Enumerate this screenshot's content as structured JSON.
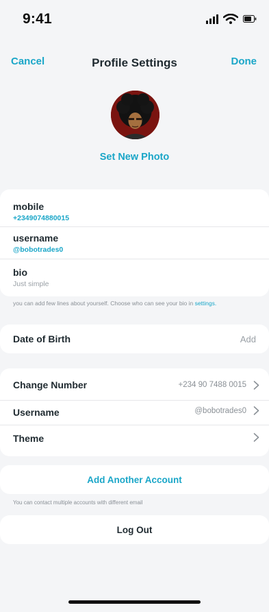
{
  "status": {
    "time": "9:41"
  },
  "nav": {
    "cancel": "Cancel",
    "title": "Profile Settings",
    "done": "Done"
  },
  "photo": {
    "set_label": "Set New Photo"
  },
  "profile": {
    "mobile_label": "mobile",
    "mobile_value": "+2349074880015",
    "username_label": "username",
    "username_value": "@bobotrades0",
    "bio_label": "bio",
    "bio_value": "Just simple"
  },
  "bio_note": {
    "text": "you can add few lines about yourself. Choose who can see your bio in ",
    "link": "settings."
  },
  "dob": {
    "label": "Date of Birth",
    "action": "Add"
  },
  "settings": {
    "change_number_label": "Change Number",
    "change_number_value": "+234 90 7488 0015",
    "username_label": "Username",
    "username_value": "@bobotrades0",
    "theme_label": "Theme"
  },
  "account": {
    "add_label": "Add Another Account",
    "note": "You can contact multiple accounts with different email"
  },
  "logout": {
    "label": "Log Out"
  },
  "colors": {
    "accent": "#1aa6c8",
    "background": "#f4f5f7"
  }
}
